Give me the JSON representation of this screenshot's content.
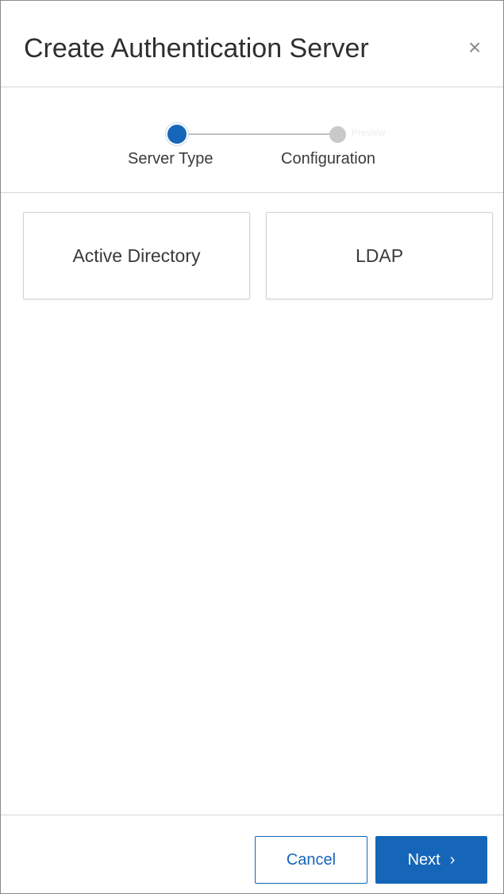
{
  "dialog": {
    "title": "Create Authentication Server",
    "close_symbol": "×"
  },
  "stepper": {
    "steps": [
      {
        "label": "Server Type",
        "state": "active"
      },
      {
        "label": "Configuration",
        "state": "inactive",
        "faint_text": "Preview"
      }
    ],
    "active_color": "#1566b8",
    "inactive_color": "#c9c9c9"
  },
  "server_types": [
    {
      "label": "Active Directory"
    },
    {
      "label": "LDAP"
    }
  ],
  "footer": {
    "cancel_label": "Cancel",
    "next_label": "Next",
    "next_icon": "›"
  },
  "colors": {
    "accent": "#1566b8"
  }
}
